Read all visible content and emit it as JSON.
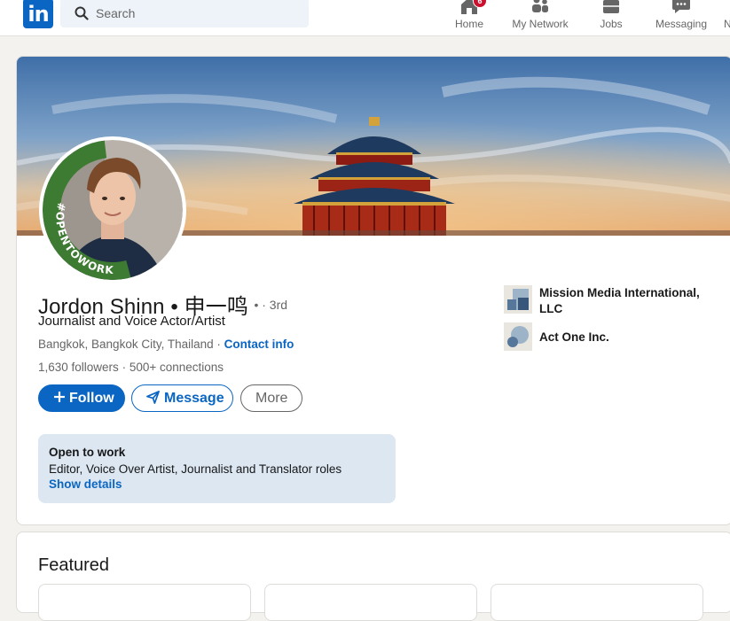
{
  "nav": {
    "logo_text": "in",
    "search_placeholder": "Search",
    "items": [
      {
        "label": "Home",
        "icon": "home-icon",
        "badge": "6"
      },
      {
        "label": "My Network",
        "icon": "people-icon"
      },
      {
        "label": "Jobs",
        "icon": "briefcase-icon"
      },
      {
        "label": "Messaging",
        "icon": "chat-icon"
      },
      {
        "label": "N",
        "icon": "bell-icon"
      }
    ]
  },
  "profile": {
    "name": "Jordon Shinn • 申一鸣",
    "degree": "• · 3rd",
    "headline": "Journalist and Voice Actor/Artist",
    "location": "Bangkok, Bangkok City, Thailand",
    "location_sep": " · ",
    "contact_info": "Contact info",
    "followers": "1,630 followers",
    "connections_sep": " · ",
    "connections": "500+ connections",
    "avatar_frame_text": "#OPENTOWORK",
    "accent_color": "#0a66c2",
    "open_to_work_color": "#3d7a32"
  },
  "actions": {
    "follow": "Follow",
    "message": "Message",
    "more": "More"
  },
  "open_to_work": {
    "title": "Open to work",
    "roles": "Editor, Voice Over Artist, Journalist and Translator roles",
    "details_link": "Show details"
  },
  "companies": [
    {
      "name": "Mission Media International, LLC",
      "icon": "building-logo"
    },
    {
      "name": "Act One Inc.",
      "icon": "company-circles-logo"
    }
  ],
  "featured": {
    "title": "Featured"
  }
}
